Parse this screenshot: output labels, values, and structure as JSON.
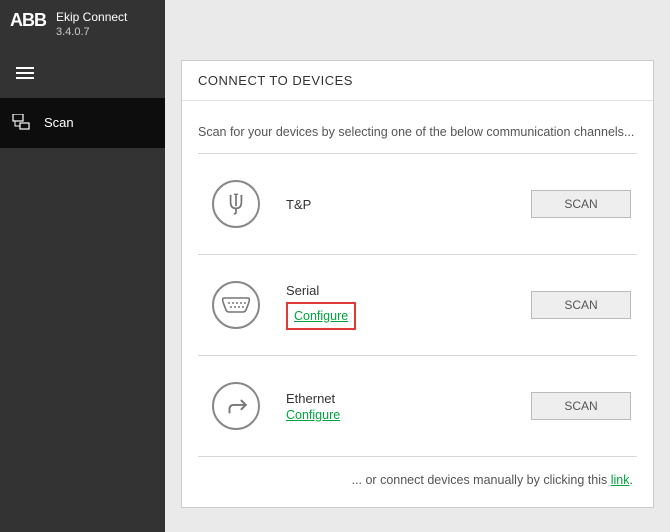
{
  "app": {
    "logo": "ABB",
    "name": "Ekip Connect",
    "version": "3.4.0.7"
  },
  "sidebar": {
    "items": [
      {
        "label": "Scan"
      }
    ]
  },
  "panel": {
    "title": "CONNECT TO DEVICES",
    "intro": "Scan for your devices by selecting one of the below communication channels...",
    "rows": [
      {
        "name": "T&P",
        "configure": null,
        "scan_label": "SCAN"
      },
      {
        "name": "Serial",
        "configure": "Configure",
        "scan_label": "SCAN",
        "highlighted": true
      },
      {
        "name": "Ethernet",
        "configure": "Configure",
        "scan_label": "SCAN"
      }
    ],
    "footer_pre": "... or connect devices manually by clicking this ",
    "footer_link": "link",
    "footer_post": "."
  }
}
